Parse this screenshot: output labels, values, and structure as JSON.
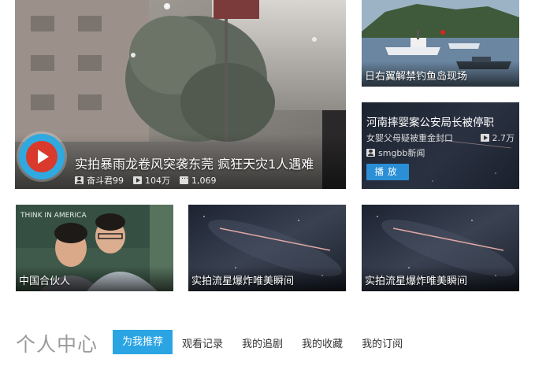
{
  "feature": {
    "title": "实拍暴雨龙卷风突袭东莞 疯狂天灾1人遇难",
    "author": "奋斗君99",
    "plays": "104万",
    "comments": "1,069"
  },
  "tiles": [
    {
      "caption": "日右翼解禁钓鱼岛现场"
    },
    {
      "caption": "中国合伙人"
    },
    {
      "caption": "实拍流星爆炸唯美瞬间"
    },
    {
      "caption": "实拍流星爆炸唯美瞬间"
    }
  ],
  "news": {
    "headline": "河南摔婴案公安局长被停职",
    "sub": "女婴父母疑被重金封口",
    "count": "2.7万",
    "source": "smgbb新闻",
    "play_label": "播放"
  },
  "personal_center": {
    "title": "个人中心",
    "tabs": [
      {
        "label": "为我推荐",
        "active": true
      },
      {
        "label": "观看记录"
      },
      {
        "label": "我的追剧"
      },
      {
        "label": "我的收藏"
      },
      {
        "label": "我的订阅"
      }
    ]
  },
  "colors": {
    "accent": "#2aa4e3",
    "play_button": "#2b8fd6",
    "title_gray": "#9a9a9a"
  }
}
